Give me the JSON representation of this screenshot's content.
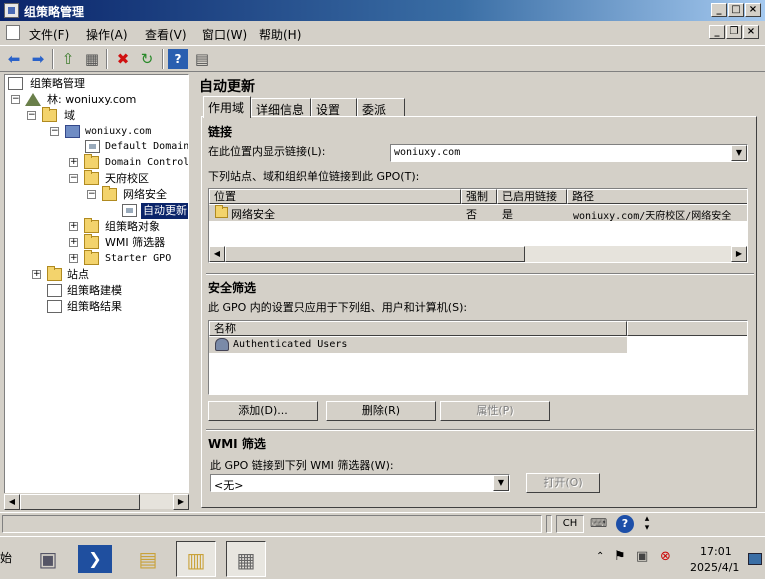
{
  "window": {
    "title": "组策略管理"
  },
  "menu": [
    "文件(F)",
    "操作(A)",
    "查看(V)",
    "窗口(W)",
    "帮助(H)"
  ],
  "tree": {
    "root": "组策略管理",
    "forest": "林: woniuxy.com",
    "domains": "域",
    "domain": "woniuxy.com",
    "default_domain": "Default Domain",
    "domain_control": "Domain Control",
    "ou_campus": "天府校区",
    "ou_network": "网络安全",
    "selected_gpo": "自动更新",
    "gpo_objects": "组策略对象",
    "wmi_filters": "WMI 筛选器",
    "starter_gpo": "Starter GPO",
    "sites": "站点",
    "modeling": "组策略建模",
    "results": "组策略结果"
  },
  "detail": {
    "title": "自动更新",
    "tabs": [
      "作用域",
      "详细信息",
      "设置",
      "委派"
    ],
    "links": {
      "heading": "链接",
      "location_label": "在此位置内显示链接(L):",
      "location_value": "woniuxy.com",
      "list_label": "下列站点、域和组织单位链接到此 GPO(T):",
      "columns": [
        "位置",
        "强制",
        "已启用链接",
        "路径"
      ],
      "rows": [
        {
          "location": "网络安全",
          "enforced": "否",
          "enabled": "是",
          "path": "woniuxy.com/天府校区/网络安全"
        }
      ]
    },
    "security": {
      "heading": "安全筛选",
      "desc": "此 GPO 内的设置只应用于下列组、用户和计算机(S):",
      "column": "名称",
      "rows": [
        "Authenticated Users"
      ],
      "add_btn": "添加(D)...",
      "remove_btn": "删除(R)",
      "props_btn": "属性(P)"
    },
    "wmi": {
      "heading": "WMI 筛选",
      "desc": "此 GPO 链接到下列 WMI 筛选器(W):",
      "value": "<无>",
      "open_btn": "打开(O)"
    }
  },
  "taskbar": {
    "start": "始",
    "lang": "CH",
    "time": "17:01",
    "date": "2025/4/1"
  }
}
